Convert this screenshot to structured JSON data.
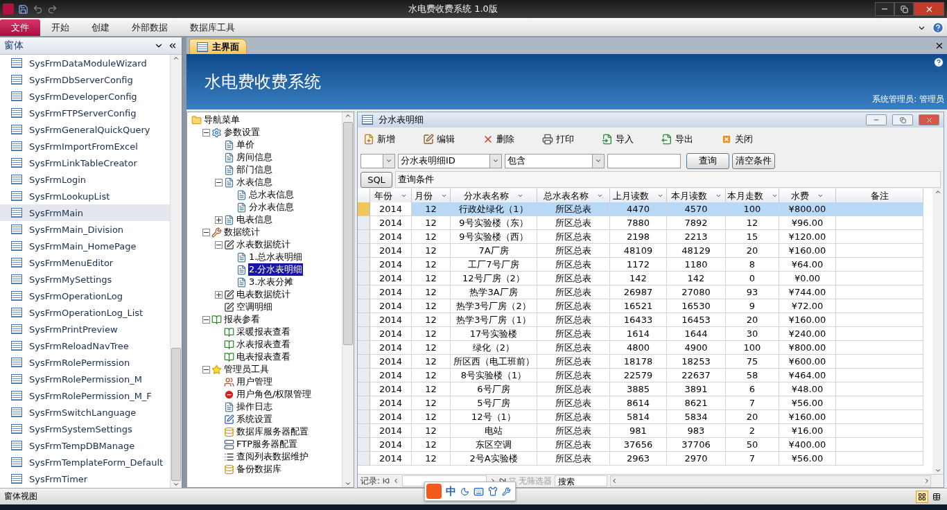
{
  "window": {
    "title": "水电费收费系统 1.0版"
  },
  "ribbon": {
    "tabs": [
      {
        "label": "文件",
        "selected": true
      },
      {
        "label": "开始",
        "selected": false
      },
      {
        "label": "创建",
        "selected": false
      },
      {
        "label": "外部数据",
        "selected": false
      },
      {
        "label": "数据库工具",
        "selected": false
      }
    ]
  },
  "nav_pane": {
    "title": "窗体",
    "items": [
      {
        "label": "SysFrmDataModuleWizard",
        "selected": false
      },
      {
        "label": "SysFrmDbServerConfig",
        "selected": false
      },
      {
        "label": "SysFrmDeveloperConfig",
        "selected": false
      },
      {
        "label": "SysFrmFTPServerConfig",
        "selected": false
      },
      {
        "label": "SysFrmGeneralQuickQuery",
        "selected": false
      },
      {
        "label": "SysFrmImportFromExcel",
        "selected": false
      },
      {
        "label": "SysFrmLinkTableCreator",
        "selected": false
      },
      {
        "label": "SysFrmLogin",
        "selected": false
      },
      {
        "label": "SysFrmLookupList",
        "selected": false
      },
      {
        "label": "SysFrmMain",
        "selected": true
      },
      {
        "label": "SysFrmMain_Division",
        "selected": false
      },
      {
        "label": "SysFrmMain_HomePage",
        "selected": false
      },
      {
        "label": "SysFrmMenuEditor",
        "selected": false
      },
      {
        "label": "SysFrmMySettings",
        "selected": false
      },
      {
        "label": "SysFrmOperationLog",
        "selected": false
      },
      {
        "label": "SysFrmOperationLog_List",
        "selected": false
      },
      {
        "label": "SysFrmPrintPreview",
        "selected": false
      },
      {
        "label": "SysFrmReloadNavTree",
        "selected": false
      },
      {
        "label": "SysFrmRolePermission",
        "selected": false
      },
      {
        "label": "SysFrmRolePermission_M",
        "selected": false
      },
      {
        "label": "SysFrmRolePermission_M_F",
        "selected": false
      },
      {
        "label": "SysFrmSwitchLanguage",
        "selected": false
      },
      {
        "label": "SysFrmSystemSettings",
        "selected": false
      },
      {
        "label": "SysFrmTempDBManage",
        "selected": false
      },
      {
        "label": "SysFrmTemplateForm_Default",
        "selected": false
      },
      {
        "label": "SysFrmTimer",
        "selected": false
      }
    ]
  },
  "document_tab": {
    "label": "主界面"
  },
  "banner": {
    "title": "水电费收费系统",
    "user": "系统管理员: 管理员"
  },
  "tree": {
    "root": {
      "label": "导航菜单",
      "kind": "folder",
      "selected": false,
      "children": [
        {
          "label": "参数设置",
          "kind": "gear",
          "expanded": true,
          "selected": false,
          "children": [
            {
              "label": "单价",
              "kind": "doc",
              "selected": false
            },
            {
              "label": "房间信息",
              "kind": "doc",
              "selected": false
            },
            {
              "label": "部门信息",
              "kind": "doc",
              "selected": false
            },
            {
              "label": "水表信息",
              "kind": "doc",
              "expanded": true,
              "selected": false,
              "children": [
                {
                  "label": "总水表信息",
                  "kind": "doc",
                  "selected": false
                },
                {
                  "label": "分水表信息",
                  "kind": "doc",
                  "selected": false
                }
              ]
            },
            {
              "label": "电表信息",
              "kind": "doc",
              "expanded": false,
              "selected": false
            }
          ]
        },
        {
          "label": "数据统计",
          "kind": "tools",
          "expanded": true,
          "selected": false,
          "children": [
            {
              "label": "水表数据统计",
              "kind": "pencil",
              "expanded": true,
              "selected": false,
              "children": [
                {
                  "label": "1.总水表明细",
                  "kind": "doc",
                  "selected": false
                },
                {
                  "label": "2.分水表明细",
                  "kind": "doc",
                  "selected": true
                },
                {
                  "label": "3.水表分摊",
                  "kind": "doc",
                  "selected": false
                }
              ]
            },
            {
              "label": "电表数据统计",
              "kind": "pencil",
              "expanded": false,
              "selected": false
            },
            {
              "label": "空调明细",
              "kind": "pencil",
              "selected": false
            }
          ]
        },
        {
          "label": "报表参看",
          "kind": "report",
          "expanded": true,
          "selected": false,
          "children": [
            {
              "label": "采暖报表查看",
              "kind": "report",
              "selected": false
            },
            {
              "label": "水表报表查看",
              "kind": "report",
              "selected": false
            },
            {
              "label": "电表报表查看",
              "kind": "report",
              "selected": false
            }
          ]
        },
        {
          "label": "管理员工具",
          "kind": "star",
          "expanded": true,
          "selected": false,
          "children": [
            {
              "label": "用户管理",
              "kind": "users",
              "selected": false
            },
            {
              "label": "用户角色/权限管理",
              "kind": "stop",
              "selected": false
            },
            {
              "label": "操作日志",
              "kind": "doc",
              "selected": false
            },
            {
              "label": "系统设置",
              "kind": "settings",
              "selected": false
            },
            {
              "label": "数据库服务器配置",
              "kind": "db",
              "selected": false
            },
            {
              "label": "FTP服务器配置",
              "kind": "server",
              "selected": false
            },
            {
              "label": "查阅列表数据维护",
              "kind": "list",
              "selected": false
            },
            {
              "label": "备份数据库",
              "kind": "db",
              "selected": false
            }
          ]
        }
      ]
    }
  },
  "subform": {
    "title": "分水表明细",
    "toolbar": [
      {
        "label": "新增",
        "kind": "new"
      },
      {
        "label": "编辑",
        "kind": "edit"
      },
      {
        "label": "删除",
        "kind": "delete"
      },
      {
        "label": "打印",
        "kind": "print"
      },
      {
        "label": "导入",
        "kind": "import"
      },
      {
        "label": "导出",
        "kind": "export"
      },
      {
        "label": "关闭",
        "kind": "close"
      }
    ],
    "filter": {
      "field": "分水表明细ID",
      "operator": "包含",
      "query_button": "查询",
      "clear_button": "清空条件",
      "sql_button": "SQL",
      "condition": "查询条件"
    },
    "table": {
      "columns": [
        "年份",
        "月份",
        "分水表名称",
        "总水表名称",
        "上月读数",
        "本月读数",
        "本月走数",
        "水费",
        "备注"
      ],
      "rows": [
        {
          "selected": true,
          "cells": [
            "2014",
            "12",
            "行政处绿化（1）",
            "所区总表",
            "4470",
            "4570",
            "100",
            "¥800.00"
          ]
        },
        {
          "selected": false,
          "cells": [
            "2014",
            "12",
            "9号实验楼（东）",
            "所区总表",
            "7880",
            "7892",
            "12",
            "¥96.00"
          ]
        },
        {
          "selected": false,
          "cells": [
            "2014",
            "12",
            "9号实验楼（西）",
            "所区总表",
            "2198",
            "2213",
            "15",
            "¥120.00"
          ]
        },
        {
          "selected": false,
          "cells": [
            "2014",
            "12",
            "7A厂房",
            "所区总表",
            "48109",
            "48129",
            "20",
            "¥160.00"
          ]
        },
        {
          "selected": false,
          "cells": [
            "2014",
            "12",
            "工厂7号厂房",
            "所区总表",
            "1172",
            "1180",
            "8",
            "¥64.00"
          ]
        },
        {
          "selected": false,
          "cells": [
            "2014",
            "12",
            "12号厂房（2）",
            "所区总表",
            "142",
            "142",
            "0",
            "¥0.00"
          ]
        },
        {
          "selected": false,
          "cells": [
            "2014",
            "12",
            "热学3A厂房",
            "所区总表",
            "26987",
            "27080",
            "93",
            "¥744.00"
          ]
        },
        {
          "selected": false,
          "cells": [
            "2014",
            "12",
            "热学3号厂房（2）",
            "所区总表",
            "16521",
            "16530",
            "9",
            "¥72.00"
          ]
        },
        {
          "selected": false,
          "cells": [
            "2014",
            "12",
            "热学3号厂房（1）",
            "所区总表",
            "16433",
            "16453",
            "20",
            "¥160.00"
          ]
        },
        {
          "selected": false,
          "cells": [
            "2014",
            "12",
            "17号实验楼",
            "所区总表",
            "1614",
            "1644",
            "30",
            "¥240.00"
          ]
        },
        {
          "selected": false,
          "cells": [
            "2014",
            "12",
            "绿化（2）",
            "所区总表",
            "4800",
            "4900",
            "100",
            "¥800.00"
          ]
        },
        {
          "selected": false,
          "cells": [
            "2014",
            "12",
            "所区西（电工班前）",
            "所区总表",
            "18178",
            "18253",
            "75",
            "¥600.00"
          ]
        },
        {
          "selected": false,
          "cells": [
            "2014",
            "12",
            "8号实验楼（1）",
            "所区总表",
            "22579",
            "22637",
            "58",
            "¥464.00"
          ]
        },
        {
          "selected": false,
          "cells": [
            "2014",
            "12",
            "6号厂房",
            "所区总表",
            "3885",
            "3891",
            "6",
            "¥48.00"
          ]
        },
        {
          "selected": false,
          "cells": [
            "2014",
            "12",
            "5号厂房",
            "所区总表",
            "8614",
            "8621",
            "7",
            "¥56.00"
          ]
        },
        {
          "selected": false,
          "cells": [
            "2014",
            "12",
            "12号（1）",
            "所区总表",
            "5814",
            "5834",
            "20",
            "¥160.00"
          ]
        },
        {
          "selected": false,
          "cells": [
            "2014",
            "12",
            "电站",
            "所区总表",
            "981",
            "983",
            "2",
            "¥16.00"
          ]
        },
        {
          "selected": false,
          "cells": [
            "2014",
            "12",
            "东区空调",
            "所区总表",
            "37656",
            "37706",
            "50",
            "¥400.00"
          ]
        },
        {
          "selected": false,
          "cells": [
            "2014",
            "12",
            "2号A实验楼",
            "所区总表",
            "2963",
            "2970",
            "7",
            "¥56.00"
          ]
        }
      ]
    },
    "record_nav": {
      "label": "记录:",
      "filter": "无筛选器",
      "search": "搜索"
    }
  },
  "ime_bar": {
    "label": "中"
  },
  "status_bar": {
    "text": "窗体视图"
  }
}
